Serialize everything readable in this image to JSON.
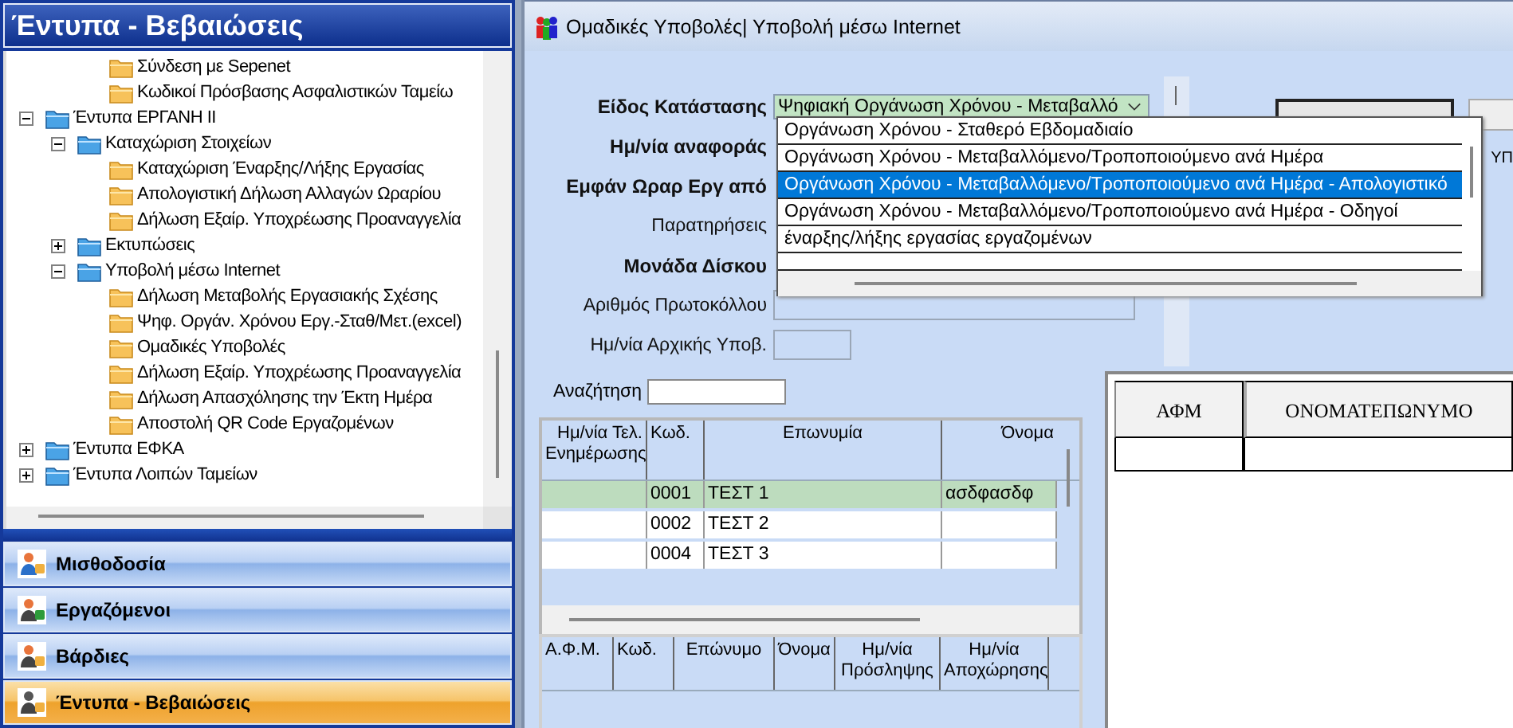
{
  "side_panel": {
    "title": "Έντυπα - Βεβαιώσεις",
    "tree": [
      {
        "expanded": true,
        "children": [
          {
            "expanded": true,
            "children": [
              {
                "label": "Σύνδεση με Sepenet"
              },
              {
                "label": "Κωδικοί Πρόσβασης Ασφαλιστικών Ταμείω"
              }
            ]
          }
        ]
      },
      {
        "label": "Έντυπα ΕΡΓΑΝΗ ΙΙ",
        "expanded": true,
        "children": [
          {
            "label": "Καταχώριση Στοιχείων",
            "expanded": true,
            "children": [
              {
                "label": "Καταχώριση Έναρξης/Λήξης Εργασίας"
              },
              {
                "label": "Απολογιστική Δήλωση Αλλαγών Ωραρίου"
              },
              {
                "label": "Δήλωση Εξαίρ. Υποχρέωσης Προαναγγελία"
              }
            ]
          },
          {
            "label": "Εκτυπώσεις",
            "expanded": false
          },
          {
            "label": "Υποβολή μέσω Internet",
            "expanded": true,
            "children": [
              {
                "label": "Δήλωση Μεταβολής Εργασιακής Σχέσης"
              },
              {
                "label": "Ψηφ. Οργάν. Χρόνου Εργ.-Σταθ/Μετ.(excel)"
              },
              {
                "label": "Ομαδικές Υποβολές"
              },
              {
                "label": "Δήλωση Εξαίρ. Υποχρέωσης Προαναγγελία"
              },
              {
                "label": "Δήλωση Απασχόλησης την Έκτη Ημέρα"
              },
              {
                "label": "Αποστολή QR Code Εργαζομένων"
              }
            ]
          }
        ]
      },
      {
        "label": "Έντυπα ΕΦΚΑ",
        "expanded": false
      },
      {
        "label": "Έντυπα Λοιπών Ταμείων",
        "expanded": false
      }
    ],
    "nav": [
      {
        "label": "Μισθοδοσία",
        "selected": false
      },
      {
        "label": "Εργαζόμενοι",
        "selected": false
      },
      {
        "label": "Βάρδιες",
        "selected": false
      },
      {
        "label": "Έντυπα - Βεβαιώσεις",
        "selected": true
      }
    ]
  },
  "window": {
    "title": "Ομαδικές Υποβολές| Υποβολή μέσω Internet"
  },
  "form": {
    "fields": [
      {
        "label": "Είδος Κατάστασης",
        "bold": true,
        "kind": "combo",
        "value": "Ψηφιακή Οργάνωση Χρόνου - Μεταβαλλό"
      },
      {
        "label": "Ημ/νία αναφοράς",
        "bold": true,
        "kind": "covered"
      },
      {
        "label": "Εμφάν Ωραρ Εργ από",
        "bold": true,
        "kind": "covered"
      },
      {
        "label": "Παρατηρήσεις",
        "bold": false,
        "kind": "covered"
      },
      {
        "label": "Μονάδα Δίσκου",
        "bold": true,
        "kind": "covered"
      },
      {
        "label": "Αριθμός Πρωτοκόλλου",
        "bold": false,
        "kind": "text"
      },
      {
        "label": "Ημ/νία Αρχικής Υποβ.",
        "bold": false,
        "kind": "date"
      }
    ]
  },
  "dropdown": {
    "items": [
      {
        "label": "Οργάνωση Χρόνου - Σταθερό Εβδομαδιαίο",
        "selected": false
      },
      {
        "label": "Οργάνωση Χρόνου - Μεταβαλλόμενο/Τροποποιούμενο ανά Ημέρα",
        "selected": false
      },
      {
        "label": "Οργάνωση Χρόνου - Μεταβαλλόμενο/Τροποποιούμενο ανά Ημέρα - Απολογιστικό",
        "selected": true
      },
      {
        "label": "Οργάνωση Χρόνου - Μεταβαλλόμενο/Τροποποιούμενο ανά Ημέρα - Οδηγοί",
        "selected": false
      },
      {
        "label": "έναρξης/λήξης εργασίας εργαζομένων",
        "selected": false
      }
    ]
  },
  "side_text": "ΥΠ",
  "search": {
    "label": "Αναζήτηση"
  },
  "companies": {
    "columns": [
      "Ημ/νία Τελ. Ενημέρωσης",
      "Κωδ.",
      "Επωνυμία",
      "Όνομα"
    ],
    "rows": [
      {
        "code": "0001",
        "name": "ΤΕΣΤ 1",
        "first_name": "ασδφασδφ",
        "selected": true
      },
      {
        "code": "0002",
        "name": "ΤΕΣΤ 2",
        "selected": false
      },
      {
        "code": "0004",
        "name": "ΤΕΣΤ 3",
        "selected": false
      }
    ]
  },
  "employees": {
    "columns": [
      "Α.Φ.Μ.",
      "Κωδ.",
      "Επώνυμο",
      "Όνομα",
      "Ημ/νία Πρόσληψης",
      "Ημ/νία Αποχώρησης"
    ]
  },
  "submissions": {
    "columns": [
      "ΑΦΜ",
      "ΟΝΟΜΑΤΕΠΩΝΥΜΟ"
    ]
  }
}
